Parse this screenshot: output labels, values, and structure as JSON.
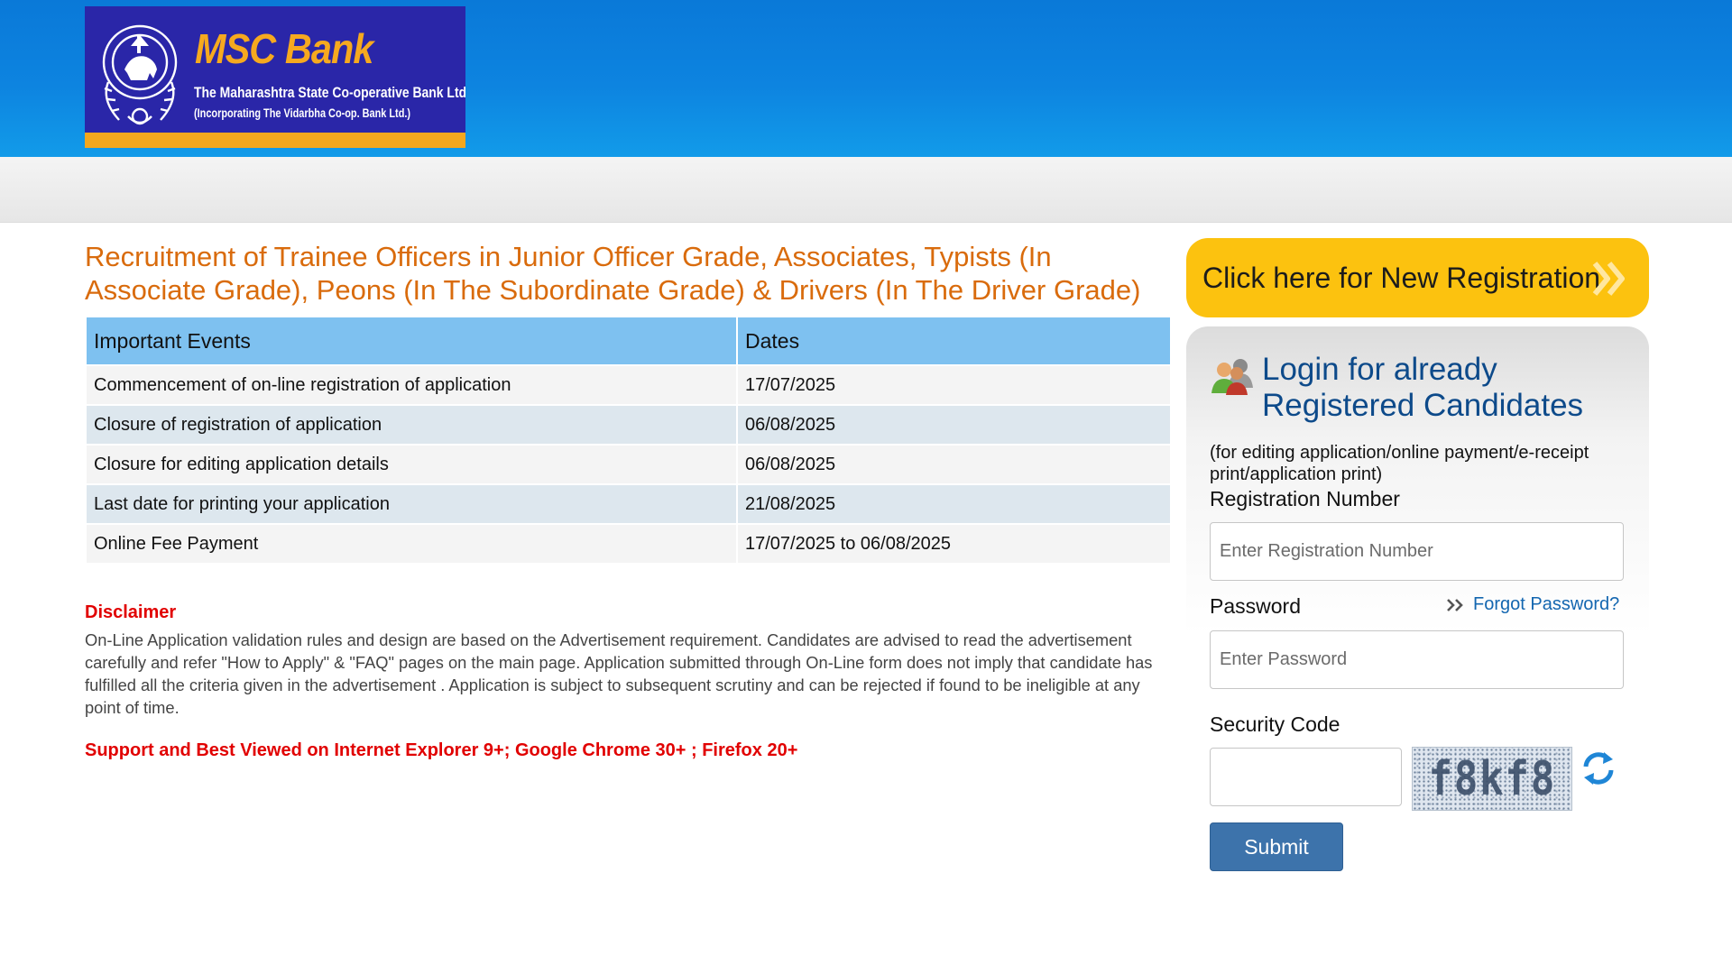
{
  "header": {
    "logo": {
      "name": "MSC Bank",
      "subtitle": "The Maharashtra State Co-operative Bank Ltd.",
      "subtitle2": "(Incorporating The Vidarbha Co-op. Bank Ltd.)",
      "colors": {
        "background": "#2a26a8",
        "accent": "#f6a91f"
      }
    }
  },
  "main": {
    "title": "Recruitment of Trainee Officers in Junior Officer Grade, Associates, Typists (In Associate Grade), Peons (In The Subordinate Grade) & Drivers (In The Driver Grade)",
    "table": {
      "headers": [
        "Important Events",
        "Dates"
      ],
      "rows": [
        {
          "event": "Commencement of on-line registration of application",
          "date": "17/07/2025"
        },
        {
          "event": "Closure of registration of application",
          "date": "06/08/2025"
        },
        {
          "event": "Closure for editing application details",
          "date": "06/08/2025"
        },
        {
          "event": "Last date for printing your application",
          "date": "21/08/2025"
        },
        {
          "event": "Online Fee Payment",
          "date": "17/07/2025 to 06/08/2025"
        }
      ]
    },
    "disclaimer": {
      "heading": "Disclaimer",
      "text": "On-Line Application validation rules and design are based on the Advertisement requirement. Candidates are advised to read the advertisement carefully and refer \"How to Apply\" & \"FAQ\" pages on the main page. Application submitted through On-Line form does not imply that candidate has fulfilled all the criteria given in the advertisement . Application is subject to subsequent scrutiny and can be rejected if found to be ineligible at any point of time."
    },
    "support_note": "Support and Best Viewed on Internet Explorer 9+; Google Chrome 30+ ; Firefox 20+"
  },
  "sidebar": {
    "new_registration": {
      "label": "Click here for New Registration",
      "icon": "double-chevron-right-icon"
    },
    "login": {
      "icon": "users-icon",
      "title": "Login for already Registered Candidates",
      "note": "(for editing application/online payment/e-receipt print/application print)",
      "registration_label": "Registration Number",
      "registration_placeholder": "Enter Registration Number",
      "password_label": "Password",
      "password_placeholder": "Enter Password",
      "forgot_password": "Forgot Password?",
      "security_code_label": "Security Code",
      "security_code_value": "",
      "captcha_text": "f8kf8",
      "submit_label": "Submit"
    }
  },
  "colors": {
    "header_blue": "#0d84e0",
    "title_orange": "#d96b0c",
    "table_header": "#7ec1f0",
    "disclaimer_red": "#e10000",
    "registration_button": "#fcc20f",
    "login_title": "#0d4a8a",
    "submit_button": "#3d73ab"
  }
}
